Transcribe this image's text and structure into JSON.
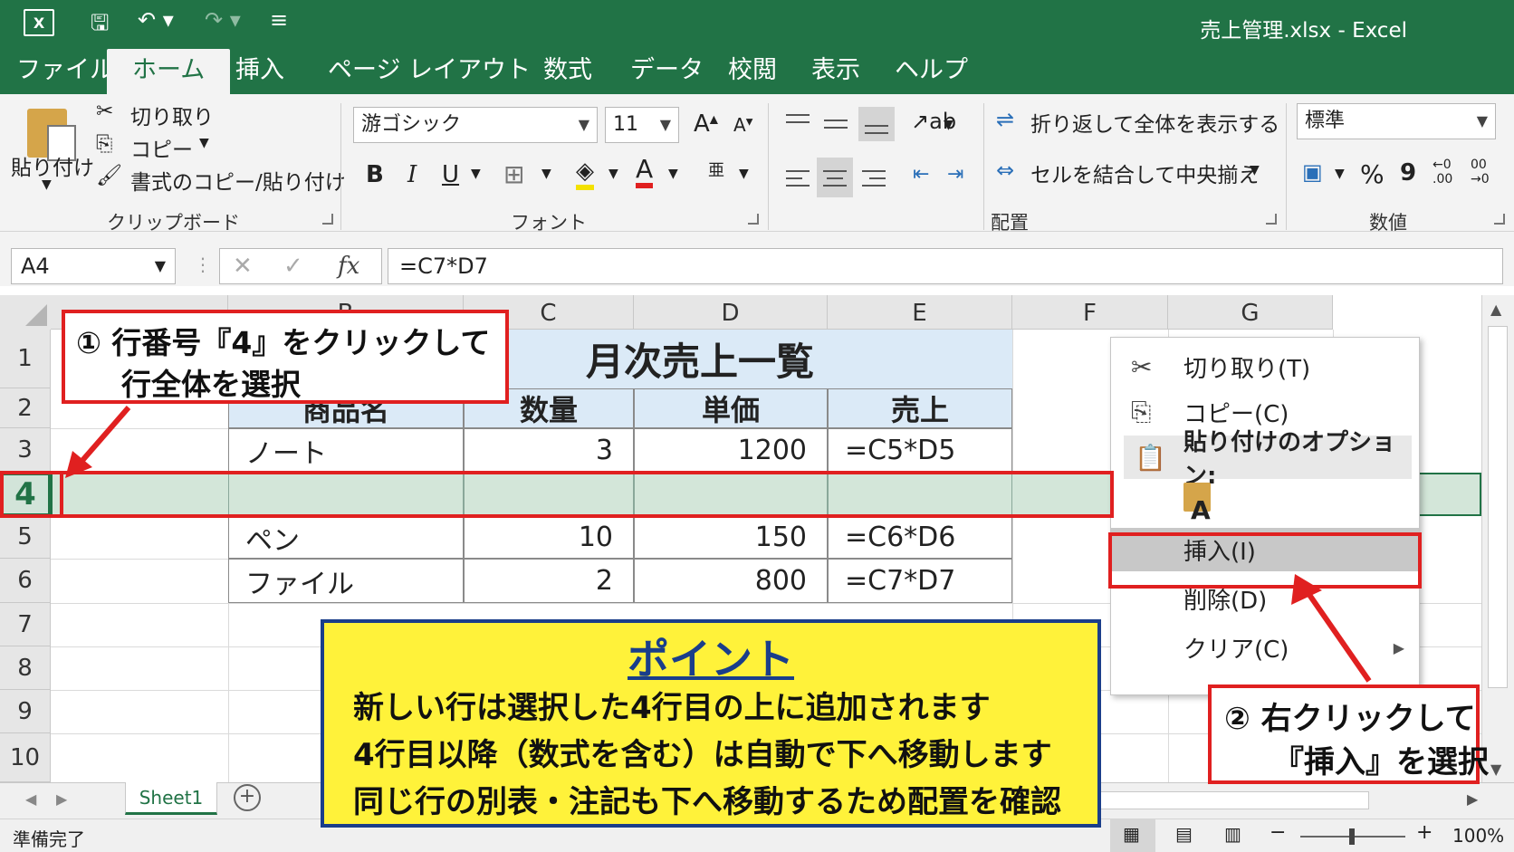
{
  "titlebar": {
    "app_icon": "excel-logo",
    "title": "売上管理.xlsx  -  Excel"
  },
  "tabs": [
    "ファイル",
    "ホーム",
    "挿入",
    "ページ レイアウト",
    "数式",
    "データ",
    "校閲",
    "表示",
    "ヘルプ"
  ],
  "ribbon": {
    "clipboard": {
      "paste": "貼り付け",
      "cut": "切り取り",
      "copy": "コピー",
      "format_painter": "書式のコピー/貼り付け",
      "label": "クリップボード"
    },
    "font": {
      "family": "游ゴシック",
      "size": "11",
      "label": "フォント",
      "bold": "B",
      "italic": "I",
      "underline": "U"
    },
    "alignment": {
      "wrap": "折り返して全体を表示する",
      "merge": "セルを結合して中央揃え",
      "label": "配置"
    },
    "number": {
      "format": "標準",
      "label": "数値",
      "percent": "%",
      "comma": "9"
    }
  },
  "formula_bar": {
    "name_box": "A4",
    "cancel": "✕",
    "enter": "✓",
    "fx": "fx",
    "formula": "=C7*D7"
  },
  "columns": [
    "B",
    "C",
    "D",
    "E",
    "F",
    "G"
  ],
  "rows": [
    "1",
    "2",
    "3",
    "4",
    "5",
    "6",
    "7",
    "8",
    "9",
    "10"
  ],
  "table": {
    "title": "月次売上一覧",
    "headers": [
      "商品名",
      "数量",
      "単価",
      "売上"
    ],
    "rows": [
      [
        "ノート",
        "3",
        "1200",
        "=C5*D5"
      ],
      [
        "ペン",
        "10",
        "150",
        "=C6*D6"
      ],
      [
        "ファイル",
        "2",
        "800",
        "=C7*D7"
      ]
    ]
  },
  "context_menu": {
    "items": [
      "切り取り(T)",
      "コピー(C)",
      "貼り付けのオプション:",
      "挿入(I)",
      "削除(D)",
      "クリア(C)"
    ],
    "paste_option_letter": "A"
  },
  "callouts": {
    "step1_line1": "① 行番号『4』をクリックして",
    "step1_line2": "行全体を選択",
    "step2_line1": "② 右クリックして",
    "step2_line2": "『挿入』を選択"
  },
  "point": {
    "title": "ポイント",
    "lines": [
      "新しい行は選択した4行目の上に追加されます",
      "4行目以降（数式を含む）は自動で下へ移動します",
      "同じ行の別表・注記も下へ移動するため配置を確認"
    ]
  },
  "sheet_tab": "Sheet1",
  "status": {
    "ready": "準備完了",
    "zoom": "100%"
  },
  "colors": {
    "excel_green": "#217346",
    "highlight_red": "#e02020",
    "point_yellow": "#fff23a",
    "point_border": "#1a3e8a",
    "header_fill": "#dbeaf7"
  }
}
